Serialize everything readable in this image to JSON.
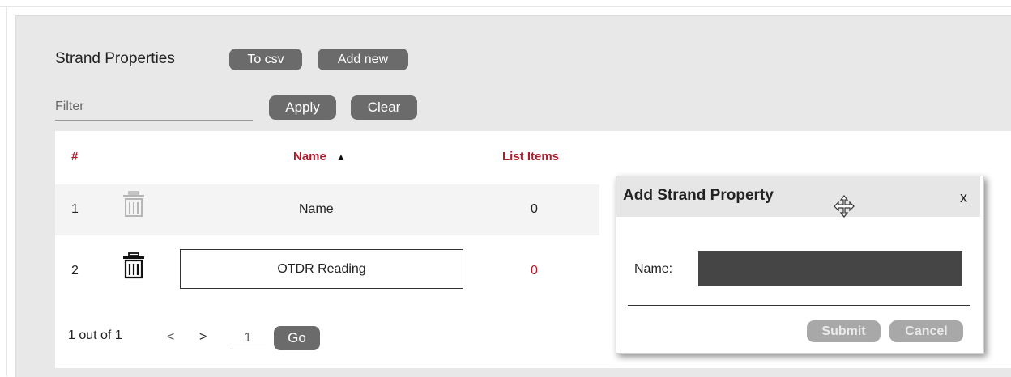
{
  "header": {
    "title": "Strand Properties",
    "to_csv_label": "To csv",
    "add_new_label": "Add new"
  },
  "filter": {
    "placeholder": "Filter",
    "apply_label": "Apply",
    "clear_label": "Clear"
  },
  "table": {
    "columns": {
      "index": "#",
      "name": "Name",
      "list_items": "List Items"
    },
    "sort_indicator": "▲",
    "rows": [
      {
        "index": "1",
        "name": "Name",
        "list_items": "0"
      },
      {
        "index": "2",
        "name": "OTDR Reading",
        "list_items": "0"
      }
    ]
  },
  "pager": {
    "summary": "1 out of 1",
    "prev": "<",
    "next": ">",
    "page": "1",
    "go_label": "Go"
  },
  "dialog": {
    "title": "Add Strand Property",
    "close_label": "x",
    "name_label": "Name:",
    "name_value": "",
    "submit_label": "Submit",
    "cancel_label": "Cancel"
  },
  "colors": {
    "header_text": "#b01c2e",
    "button_bg": "#6b6b6b",
    "input_bg": "#454545"
  }
}
